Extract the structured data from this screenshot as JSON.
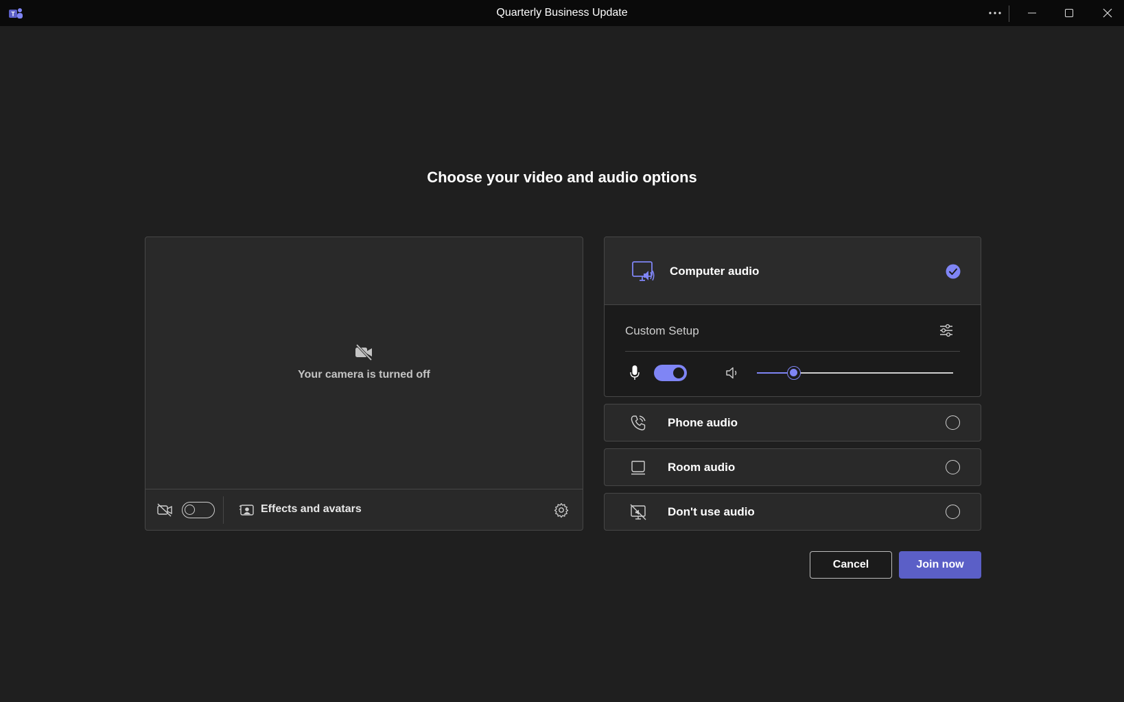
{
  "window": {
    "title": "Quarterly Business Update",
    "icons": [
      "teams-logo-icon",
      "more-options-icon",
      "minimize-icon",
      "maximize-icon",
      "close-icon"
    ]
  },
  "heading": "Choose your video and audio options",
  "video": {
    "camera_off_text": "Your camera is turned off",
    "camera_toggle_on": false,
    "effects_label": "Effects and avatars"
  },
  "audio": {
    "computer_audio": {
      "label": "Computer audio",
      "selected": true,
      "device_label": "Custom Setup",
      "mic_on": true,
      "volume": 0.19
    },
    "options": [
      {
        "label": "Phone audio",
        "icon": "phone-icon",
        "selected": false
      },
      {
        "label": "Room audio",
        "icon": "room-icon",
        "selected": false
      },
      {
        "label": "Don't use audio",
        "icon": "no-audio-icon",
        "selected": false
      }
    ]
  },
  "actions": {
    "cancel_label": "Cancel",
    "join_label": "Join now"
  },
  "colors": {
    "accent": "#7f85f5",
    "primary_button": "#5b5fc7",
    "background": "#1f1f1f",
    "panel": "#292929"
  }
}
